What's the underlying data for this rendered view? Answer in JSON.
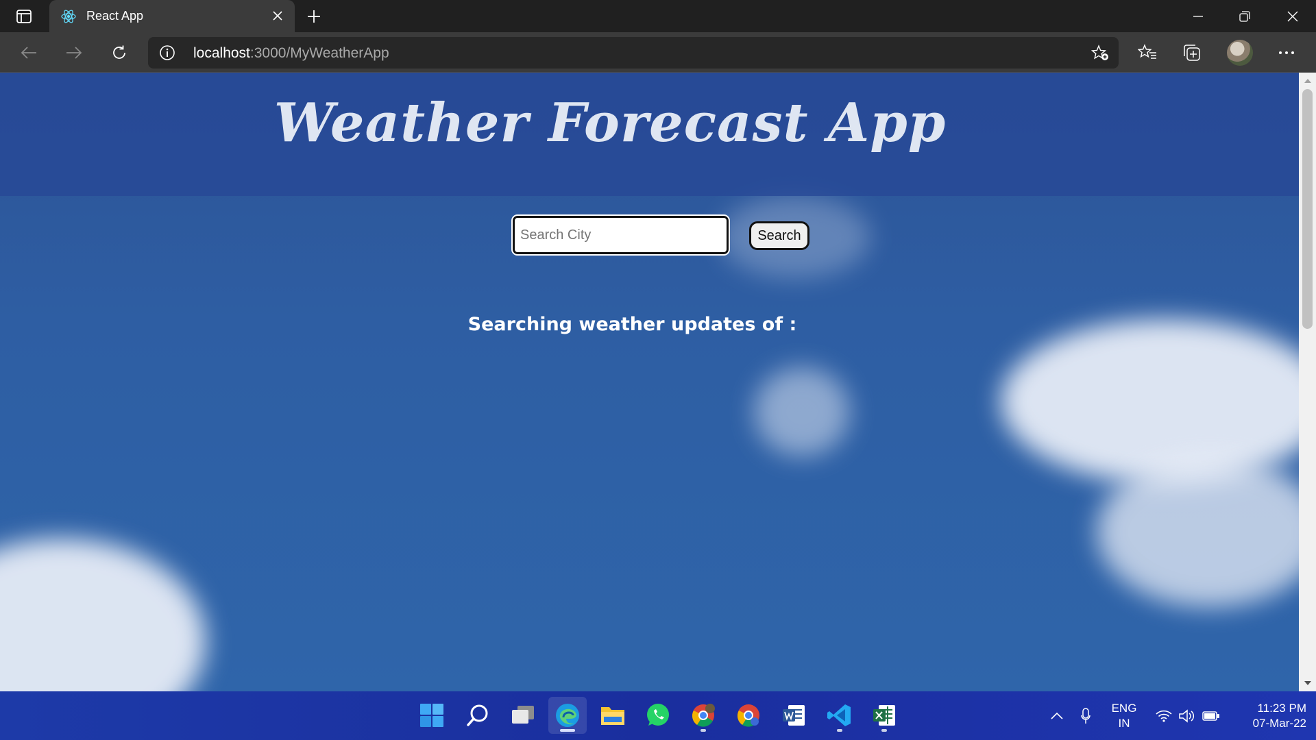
{
  "browser": {
    "tab": {
      "title": "React App",
      "favicon": "react-icon"
    },
    "url_host": "localhost",
    "url_rest": ":3000/MyWeatherApp"
  },
  "page": {
    "title": "Weather Forecast App",
    "search_placeholder": "Search City",
    "search_button": "Search",
    "status_text": "Searching weather updates of :"
  },
  "taskbar": {
    "apps": [
      "start-icon",
      "search-icon",
      "task-view-icon",
      "edge-icon",
      "file-explorer-icon",
      "whatsapp-icon",
      "chrome-profile-icon",
      "chrome-icon",
      "word-icon",
      "vscode-icon",
      "excel-icon"
    ],
    "language_line1": "ENG",
    "language_line2": "IN",
    "time": "11:23 PM",
    "date": "07-Mar-22"
  },
  "colors": {
    "header_band": "#2a4a96",
    "sky": "#2f5fa6",
    "title_text": "#dfe6f2"
  }
}
